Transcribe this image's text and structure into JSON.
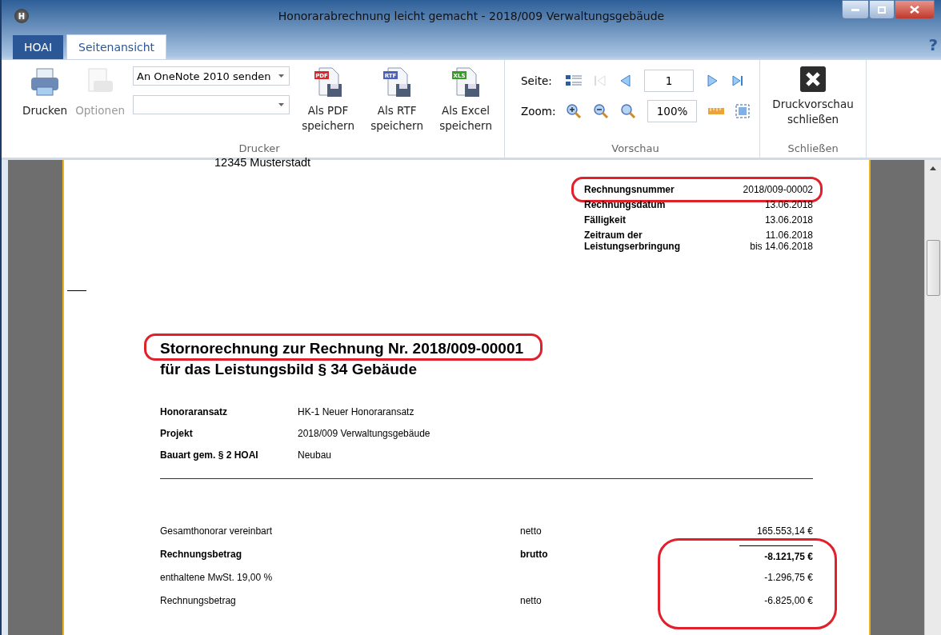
{
  "window": {
    "title": "Honorarabrechnung leicht gemacht - 2018/009 Verwaltungsgebäude",
    "app_badge": "H"
  },
  "tabs": [
    {
      "label": "HOAI",
      "selected": false,
      "kind": "file"
    },
    {
      "label": "Seitenansicht",
      "selected": true,
      "kind": "tab"
    }
  ],
  "help": "?",
  "ribbon": {
    "groups": [
      {
        "label": "Drucker",
        "kind": "printer",
        "buttons": [
          {
            "label": "Drucken",
            "disabled": false
          },
          {
            "label": "Optionen",
            "disabled": true
          }
        ],
        "printer_select": "An OneNote 2010 senden",
        "saves": [
          {
            "label": "Als PDF speichern",
            "tag": "PDF",
            "color": "#d8282c"
          },
          {
            "label": "Als RTF speichern",
            "tag": "RTF",
            "color": "#4a5fc0"
          },
          {
            "label": "Als Excel speichern",
            "tag": "XLS",
            "color": "#3a9a2a"
          }
        ]
      },
      {
        "label": "Vorschau",
        "kind": "preview",
        "page_label": "Seite:",
        "page": "1",
        "zoom_label": "Zoom:",
        "zoom": "100%",
        "first_disabled": true
      },
      {
        "label": "Schließen",
        "kind": "close",
        "button": "Druckvorschau schließen"
      }
    ]
  },
  "document": {
    "address_line": "12345 Musterstadt",
    "info": [
      {
        "label": "Rechnungsnummer",
        "value": "2018/009-00002",
        "highlighted": true
      },
      {
        "label": "Rechnungsdatum",
        "value": "13.06.2018",
        "highlighted": false
      },
      {
        "label": "Fälligkeit",
        "value": "13.06.2018",
        "highlighted": false
      },
      {
        "label": "Zeitraum der Leistungserbringung",
        "value": "11.06.2018 bis 14.06.2018",
        "highlighted": false
      }
    ],
    "heading": "Stornorechnung zur Rechnung Nr. 2018/009-00001",
    "heading_highlighted": true,
    "subheading": "für das Leistungsbild § 34 Gebäude",
    "details": [
      {
        "label": "Honoraransatz",
        "value": "HK-1 Neuer Honoraransatz"
      },
      {
        "label": "Projekt",
        "value": "2018/009 Verwaltungsgebäude"
      },
      {
        "label": "Bauart gem. § 2 HOAI",
        "value": "Neubau"
      }
    ],
    "amounts": [
      {
        "label": "Gesamthonorar vereinbart",
        "basis": "netto",
        "value": "165.553,14 €",
        "bold": false
      },
      {
        "label": "Rechnungsbetrag",
        "basis": "brutto",
        "value": "-8.121,75 €",
        "bold": true
      },
      {
        "label": "enthaltene MwSt. 19,00 %",
        "value": "-1.296,75 €",
        "bold": false
      },
      {
        "label": "Rechnungsbetrag",
        "basis": "netto",
        "value": "-6.825,00 €",
        "bold": false
      }
    ],
    "amounts_highlighted": true
  }
}
